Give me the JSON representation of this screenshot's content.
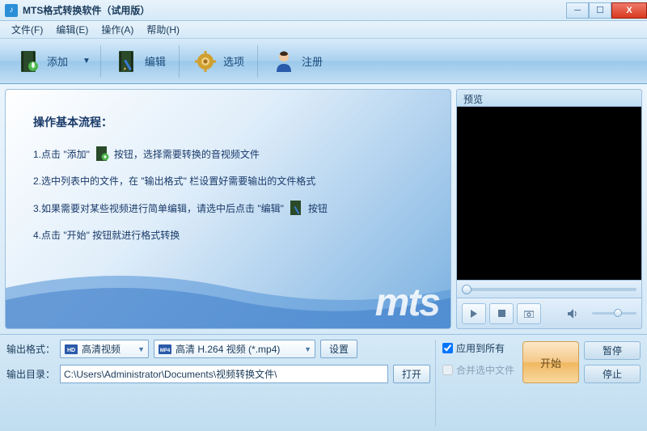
{
  "window": {
    "title": "MTS格式转换软件（试用版）"
  },
  "menu": {
    "file": "文件(F)",
    "edit": "编辑(E)",
    "action": "操作(A)",
    "help": "帮助(H)"
  },
  "toolbar": {
    "add": "添加",
    "edit": "编辑",
    "options": "选项",
    "register": "注册"
  },
  "preview": {
    "title": "预览"
  },
  "guide": {
    "heading": "操作基本流程：",
    "step1a": "1.点击 \"添加\"",
    "step1b": "按钮，选择需要转换的音视频文件",
    "step2": "2.选中列表中的文件，在 \"输出格式\" 栏设置好需要输出的文件格式",
    "step3a": "3.如果需要对某些视频进行简单编辑，请选中后点击 \"编辑\"",
    "step3b": "按钮",
    "step4": "4.点击 \"开始\" 按钮就进行格式转换"
  },
  "output": {
    "format_label": "输出格式：",
    "dir_label": "输出目录：",
    "category": "高清视频",
    "format": "高清 H.264 视频 (*.mp4)",
    "dir": "C:\\Users\\Administrator\\Documents\\视频转换文件\\",
    "settings_btn": "设置",
    "open_btn": "打开"
  },
  "options": {
    "apply_all": "应用到所有",
    "merge": "合并选中文件"
  },
  "actions": {
    "start": "开始",
    "pause": "暂停",
    "stop": "停止"
  }
}
